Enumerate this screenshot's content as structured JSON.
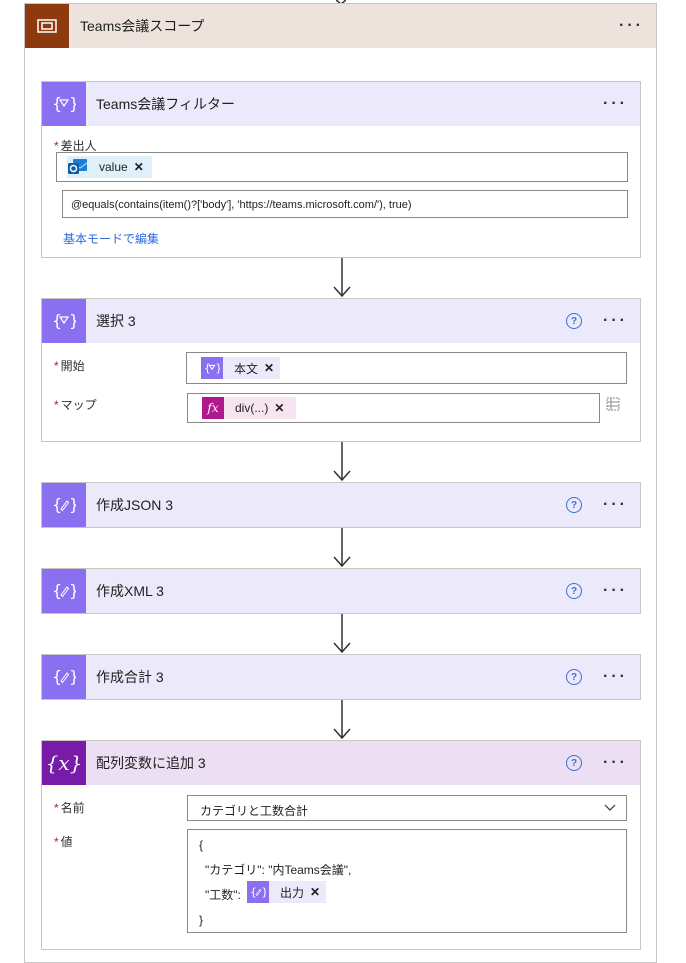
{
  "scope": {
    "title": "Teams会議スコープ"
  },
  "filter": {
    "title": "Teams会議フィルター",
    "from_label": "差出人",
    "from_token": "value",
    "expression": "@equals(contains(item()?['body'], 'https://teams.microsoft.com/'), true)",
    "basic_mode_link": "基本モードで編集"
  },
  "select": {
    "title": "選択 3",
    "from_label": "開始",
    "from_token": "本文",
    "map_label": "マップ",
    "map_token": "div(...)"
  },
  "compose_json": {
    "title": "作成JSON 3"
  },
  "compose_xml": {
    "title": "作成XML 3"
  },
  "compose_total": {
    "title": "作成合計 3"
  },
  "append": {
    "title": "配列変数に追加 3",
    "name_label": "名前",
    "name_value": "カテゴリと工数合計",
    "value_label": "値",
    "value_lines": [
      "{",
      "\"カテゴリ\": \"内Teams会議\",",
      "\"工数\":",
      "}"
    ],
    "value_token": "出力"
  },
  "icons": {
    "scope": "scope-icon",
    "filter": "filter-icon",
    "compose": "compose-icon",
    "variable": "variable-icon",
    "outlook": "outlook-icon",
    "fx": "fx-icon",
    "help": "help-icon",
    "more": "more-icon"
  },
  "colors": {
    "scope_header": "#ede3dc",
    "scope_icon": "#8e3a0f",
    "action_header": "#ece9fb",
    "action_icon": "#8a6ff0",
    "variable_header": "#ecdff3",
    "variable_icon": "#771ba8",
    "fx_icon": "#b0198c",
    "link": "#2d6be0"
  }
}
